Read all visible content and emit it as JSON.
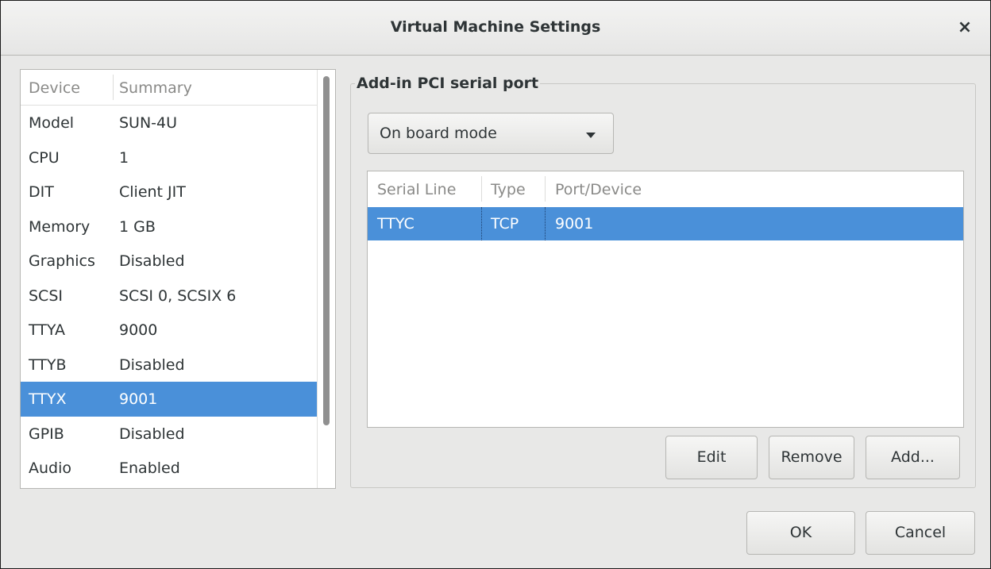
{
  "window": {
    "title": "Virtual Machine Settings",
    "close_glyph": "×"
  },
  "device_list": {
    "columns": [
      "Device",
      "Summary"
    ],
    "rows": [
      {
        "device": "Model",
        "summary": "SUN-4U"
      },
      {
        "device": "CPU",
        "summary": "1"
      },
      {
        "device": "DIT",
        "summary": "Client JIT"
      },
      {
        "device": "Memory",
        "summary": "1 GB"
      },
      {
        "device": "Graphics",
        "summary": "Disabled"
      },
      {
        "device": "SCSI",
        "summary": "SCSI 0, SCSIX 6"
      },
      {
        "device": "TTYA",
        "summary": "9000"
      },
      {
        "device": "TTYB",
        "summary": "Disabled"
      },
      {
        "device": "TTYX",
        "summary": "9001"
      },
      {
        "device": "GPIB",
        "summary": "Disabled"
      },
      {
        "device": "Audio",
        "summary": "Enabled"
      }
    ],
    "selected_device": "TTYX"
  },
  "serial_port": {
    "frame_title": "Add-in PCI serial port",
    "mode": "On board mode",
    "columns": [
      "Serial Line",
      "Type",
      "Port/Device"
    ],
    "rows": [
      {
        "serial_line": "TTYC",
        "type": "TCP",
        "port": "9001"
      }
    ],
    "buttons": {
      "edit": "Edit",
      "remove": "Remove",
      "add": "Add..."
    }
  },
  "footer": {
    "ok": "OK",
    "cancel": "Cancel"
  },
  "colors": {
    "selection": "#4a90d9",
    "window_bg": "#e8e8e7"
  }
}
